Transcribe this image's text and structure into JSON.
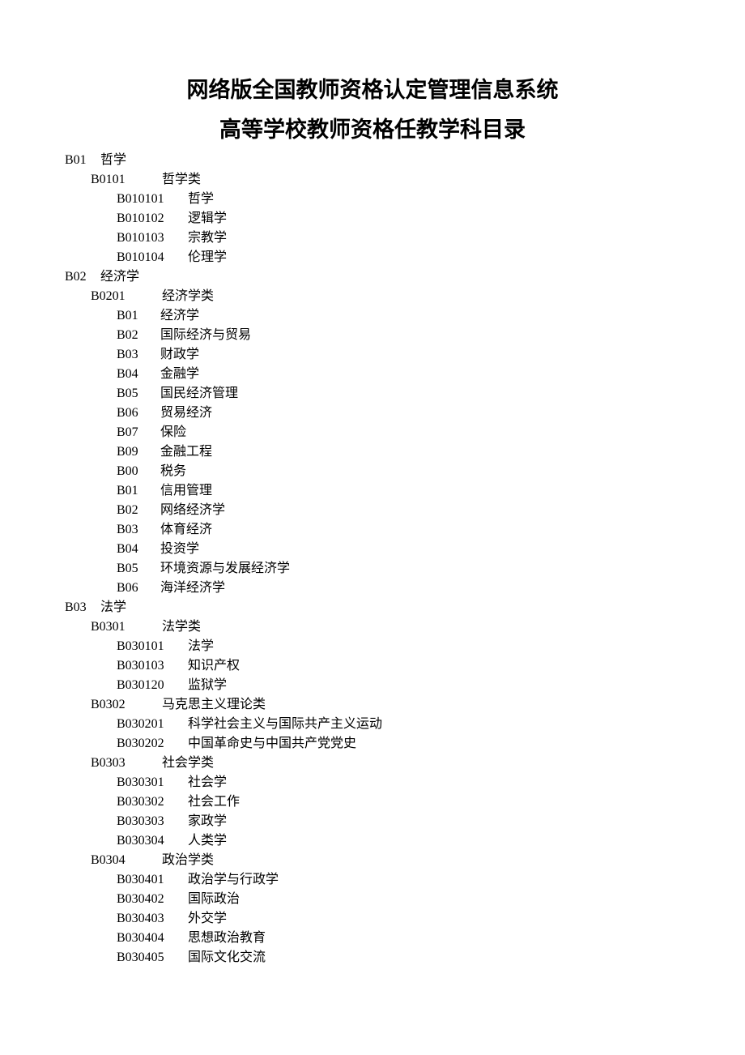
{
  "title": "网络版全国教师资格认定管理信息系统",
  "subtitle": "高等学校教师资格任教学科目录",
  "catalog": [
    {
      "code": "B01",
      "name": "哲学",
      "children": [
        {
          "code": "B0101",
          "name": "哲学类",
          "children": [
            {
              "code": "B010101",
              "name": "哲学"
            },
            {
              "code": "B010102",
              "name": "逻辑学"
            },
            {
              "code": "B010103",
              "name": "宗教学"
            },
            {
              "code": "B010104",
              "name": "伦理学"
            }
          ]
        }
      ]
    },
    {
      "code": "B02",
      "name": "经济学",
      "children": [
        {
          "code": "B0201",
          "name": "经济学类",
          "children": [
            {
              "code": "B01",
              "name": "经济学",
              "short": true
            },
            {
              "code": "B02",
              "name": "国际经济与贸易",
              "short": true
            },
            {
              "code": "B03",
              "name": "财政学",
              "short": true
            },
            {
              "code": "B04",
              "name": "金融学",
              "short": true
            },
            {
              "code": "B05",
              "name": "国民经济管理",
              "short": true
            },
            {
              "code": "B06",
              "name": "贸易经济",
              "short": true
            },
            {
              "code": "B07",
              "name": "保险",
              "short": true
            },
            {
              "code": "B09",
              "name": "金融工程",
              "short": true
            },
            {
              "code": "B00",
              "name": "税务",
              "short": true
            },
            {
              "code": "B01",
              "name": "信用管理",
              "short": true
            },
            {
              "code": "B02",
              "name": "网络经济学",
              "short": true
            },
            {
              "code": "B03",
              "name": "体育经济",
              "short": true
            },
            {
              "code": "B04",
              "name": "投资学",
              "short": true
            },
            {
              "code": "B05",
              "name": "环境资源与发展经济学",
              "short": true
            },
            {
              "code": "B06",
              "name": "海洋经济学",
              "short": true
            }
          ]
        }
      ]
    },
    {
      "code": "B03",
      "name": "法学",
      "children": [
        {
          "code": "B0301",
          "name": "法学类",
          "children": [
            {
              "code": "B030101",
              "name": "法学"
            },
            {
              "code": "B030103",
              "name": "知识产权"
            },
            {
              "code": "B030120",
              "name": "监狱学"
            }
          ]
        },
        {
          "code": "B0302",
          "name": "马克思主义理论类",
          "children": [
            {
              "code": "B030201",
              "name": "科学社会主义与国际共产主义运动"
            },
            {
              "code": "B030202",
              "name": "中国革命史与中国共产党党史"
            }
          ]
        },
        {
          "code": "B0303",
          "name": "社会学类",
          "children": [
            {
              "code": "B030301",
              "name": "社会学"
            },
            {
              "code": "B030302",
              "name": "社会工作"
            },
            {
              "code": "B030303",
              "name": "家政学"
            },
            {
              "code": "B030304",
              "name": "人类学"
            }
          ]
        },
        {
          "code": "B0304",
          "name": "政治学类",
          "children": [
            {
              "code": "B030401",
              "name": "政治学与行政学"
            },
            {
              "code": "B030402",
              "name": "国际政治"
            },
            {
              "code": "B030403",
              "name": "外交学"
            },
            {
              "code": "B030404",
              "name": "思想政治教育"
            },
            {
              "code": "B030405",
              "name": "国际文化交流"
            }
          ]
        }
      ]
    }
  ]
}
